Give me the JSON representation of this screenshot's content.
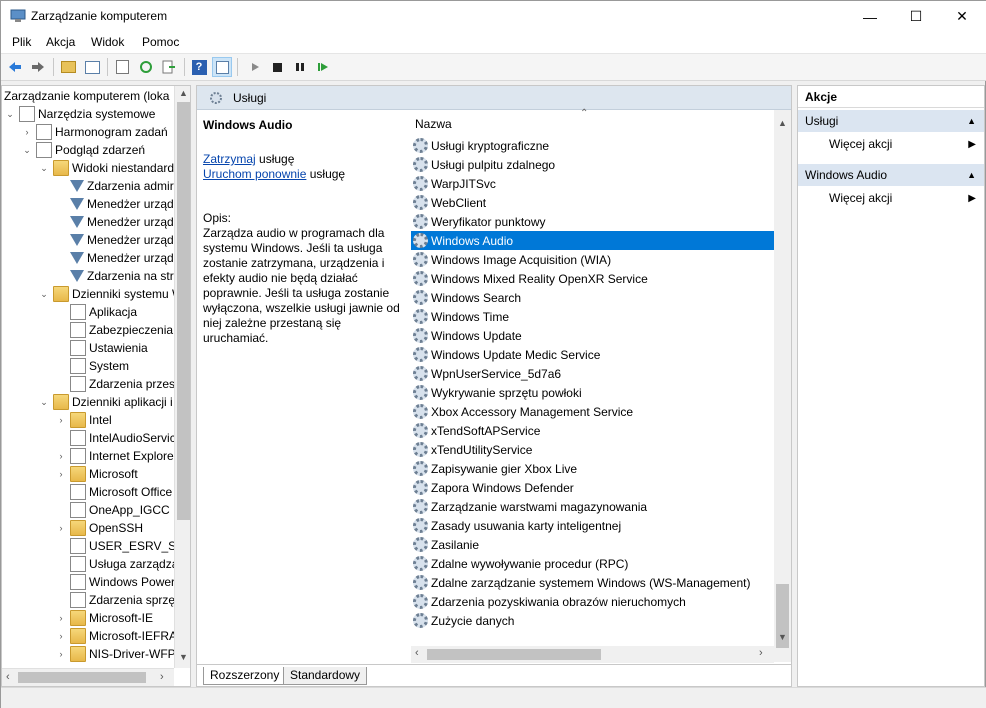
{
  "window": {
    "title": "Zarządzanie komputerem"
  },
  "menu": [
    "Plik",
    "Akcja",
    "Widok",
    "Pomoc"
  ],
  "tree": {
    "root": "Zarządzanie komputerem (loka",
    "items": [
      {
        "label": "Narzędzia systemowe",
        "icon": "tools-icon"
      },
      {
        "label": "Harmonogram zadań",
        "icon": "clock-icon"
      },
      {
        "label": "Podgląd zdarzeń",
        "icon": "event-viewer-icon"
      },
      {
        "label": "Widoki niestandard",
        "icon": "folder-icon"
      },
      {
        "label": "Zdarzenia admir",
        "icon": "filter-icon"
      },
      {
        "label": "Menedżer urząd",
        "icon": "filter-icon"
      },
      {
        "label": "Menedżer urząd",
        "icon": "filter-icon"
      },
      {
        "label": "Menedżer urząd",
        "icon": "filter-icon"
      },
      {
        "label": "Menedżer urząd",
        "icon": "filter-icon"
      },
      {
        "label": "Zdarzenia na str",
        "icon": "filter-icon"
      },
      {
        "label": "Dzienniki systemu W",
        "icon": "folder-icon"
      },
      {
        "label": "Aplikacja",
        "icon": "log-icon"
      },
      {
        "label": "Zabezpieczenia",
        "icon": "log-icon"
      },
      {
        "label": "Ustawienia",
        "icon": "log-icon"
      },
      {
        "label": "System",
        "icon": "log-icon"
      },
      {
        "label": "Zdarzenia przesy",
        "icon": "log-icon"
      },
      {
        "label": "Dzienniki aplikacji i",
        "icon": "folder-icon"
      },
      {
        "label": "Intel",
        "icon": "folder-icon"
      },
      {
        "label": "IntelAudioServic",
        "icon": "log-icon"
      },
      {
        "label": "Internet Explore",
        "icon": "log-icon"
      },
      {
        "label": "Microsoft",
        "icon": "folder-icon"
      },
      {
        "label": "Microsoft Office",
        "icon": "log-icon"
      },
      {
        "label": "OneApp_IGCC",
        "icon": "log-icon"
      },
      {
        "label": "OpenSSH",
        "icon": "folder-icon"
      },
      {
        "label": "USER_ESRV_SVC",
        "icon": "log-icon"
      },
      {
        "label": "Usługa zarządza",
        "icon": "log-icon"
      },
      {
        "label": "Windows Power",
        "icon": "log-icon"
      },
      {
        "label": "Zdarzenia sprzęt",
        "icon": "log-icon"
      },
      {
        "label": "Microsoft-IE",
        "icon": "folder-icon"
      },
      {
        "label": "Microsoft-IEFRA",
        "icon": "folder-icon"
      },
      {
        "label": "NIS-Driver-WFP",
        "icon": "folder-icon"
      }
    ]
  },
  "middle": {
    "header": "Usługi",
    "selected_service": "Windows Audio",
    "stop_link": "Zatrzymaj",
    "stop_suffix": "usługę",
    "restart_link": "Uruchom ponownie",
    "restart_suffix": "usługę",
    "desc_label": "Opis:",
    "desc_text": "Zarządza audio w programach dla systemu Windows. Jeśli ta usługa zostanie zatrzymana, urządzenia i efekty audio nie będą działać poprawnie. Jeśli ta usługa zostanie wyłączona, wszelkie usługi jawnie od niej zależne przestaną się uruchamiać.",
    "column": "Nazwa",
    "services": [
      "Usługi kryptograficzne",
      "Usługi pulpitu zdalnego",
      "WarpJITSvc",
      "WebClient",
      "Weryfikator punktowy",
      "Windows Audio",
      "Windows Image Acquisition (WIA)",
      "Windows Mixed Reality OpenXR Service",
      "Windows Search",
      "Windows Time",
      "Windows Update",
      "Windows Update Medic Service",
      "WpnUserService_5d7a6",
      "Wykrywanie sprzętu powłoki",
      "Xbox Accessory Management Service",
      "xTendSoftAPService",
      "xTendUtilityService",
      "Zapisywanie gier Xbox Live",
      "Zapora Windows Defender",
      "Zarządzanie warstwami magazynowania",
      "Zasady usuwania karty inteligentnej",
      "Zasilanie",
      "Zdalne wywoływanie procedur (RPC)",
      "Zdalne zarządzanie systemem Windows (WS-Management)",
      "Zdarzenia pozyskiwania obrazów nieruchomych",
      "Zużycie danych"
    ],
    "tabs": [
      "Rozszerzony",
      "Standardowy"
    ]
  },
  "actions": {
    "title": "Akcje",
    "section1": "Usługi",
    "more1": "Więcej akcji",
    "section2": "Windows Audio",
    "more2": "Więcej akcji"
  }
}
